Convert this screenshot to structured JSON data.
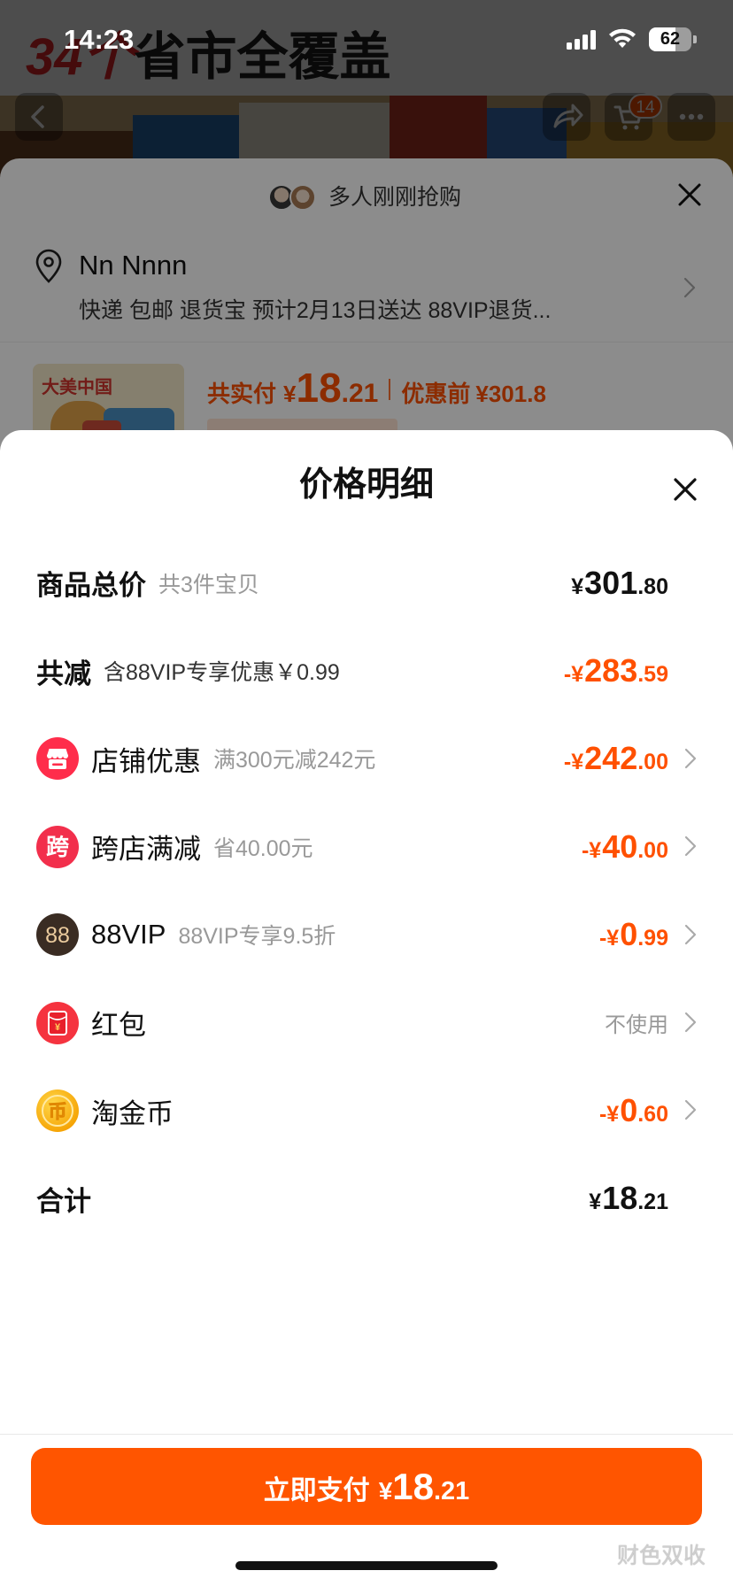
{
  "status_bar": {
    "time": "14:23",
    "battery_level": "62",
    "icons": [
      "signal-icon",
      "wifi-icon",
      "battery-icon"
    ]
  },
  "background_page": {
    "banner_highlight": "34个",
    "banner_text": "省市全覆盖",
    "cart_badge": "14",
    "icons": {
      "back": "chevron-left-icon",
      "share": "share-icon",
      "cart": "cart-icon",
      "more": "more-icon"
    }
  },
  "order_sheet": {
    "buying_notice": "多人刚刚抢购",
    "address_name": "Nn Nnnn",
    "delivery_info": "快递 包邮 退货宝 预计2月13日送达 88VIP退货...",
    "product_thumb_text": "大美中国",
    "paid_label": "共实付",
    "paid_currency": "¥",
    "paid_integer": "18",
    "paid_decimal": ".21",
    "before_label": "优惠前",
    "before_value": "¥301.8"
  },
  "price_detail": {
    "title": "价格明细",
    "rows": [
      {
        "label": "商品总价",
        "sub": "共3件宝贝",
        "prefix": "¥",
        "integer": "301",
        "decimal": ".80"
      },
      {
        "label": "共减",
        "sub": "含88VIP专享优惠￥0.99",
        "prefix": "-¥",
        "integer": "283",
        "decimal": ".59"
      },
      {
        "icon": "shop-icon",
        "label": "店铺优惠",
        "sub": "满300元减242元",
        "prefix": "-¥",
        "integer": "242",
        "decimal": ".00"
      },
      {
        "icon": "cross-store-icon",
        "icon_text": "跨",
        "label": "跨店满减",
        "sub": "省40.00元",
        "prefix": "-¥",
        "integer": "40",
        "decimal": ".00"
      },
      {
        "icon": "vip88-icon",
        "icon_text": "88",
        "label": "88VIP",
        "sub": "88VIP专享9.5折",
        "prefix": "-¥",
        "integer": "0",
        "decimal": ".99"
      },
      {
        "icon": "red-packet-icon",
        "icon_text": "¥",
        "label": "红包",
        "status": "不使用"
      },
      {
        "icon": "coin-icon",
        "icon_text": "币",
        "label": "淘金币",
        "prefix": "-¥",
        "integer": "0",
        "decimal": ".60"
      },
      {
        "label": "合计",
        "prefix": "¥",
        "integer": "18",
        "decimal": ".21"
      }
    ]
  },
  "pay_button": {
    "label": "立即支付",
    "currency": "¥",
    "integer": "18",
    "decimal": ".21"
  },
  "watermark": "财色双收",
  "colors": {
    "accent": "#FF5000",
    "discount": "#FF5000",
    "text": "#111111",
    "muted": "#999999"
  }
}
